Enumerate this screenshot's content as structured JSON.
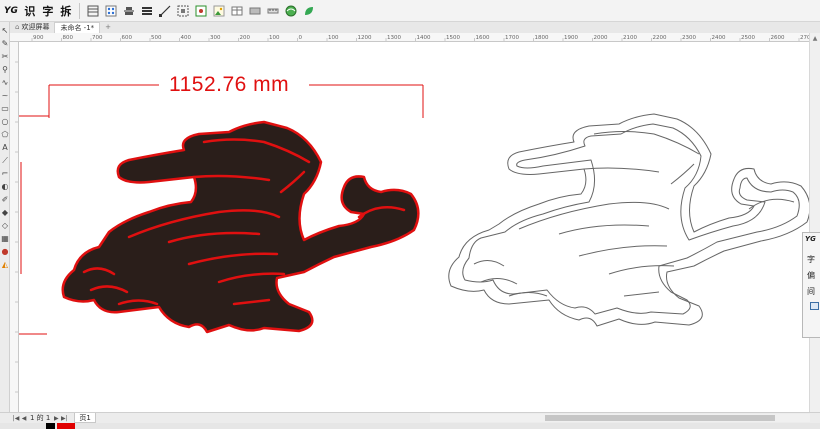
{
  "toolbar": {
    "logo_label": "YG",
    "btn_recognize": "识",
    "btn_text": "字",
    "btn_break": "拆",
    "icons": [
      "grid-icon",
      "dots-icon",
      "align-icon",
      "distribute-icon",
      "line-icon",
      "group-icon",
      "node-icon",
      "image-icon",
      "table-icon",
      "pattern-icon",
      "ruler-icon",
      "globe-icon",
      "leaf-icon"
    ]
  },
  "tabs": [
    {
      "label": "欢迎屏幕",
      "active": false
    },
    {
      "label": "未命名 -1*",
      "active": true
    }
  ],
  "ruler": {
    "h_ticks": [
      "900",
      "800",
      "700",
      "600",
      "500",
      "400",
      "300",
      "200",
      "100",
      "0",
      "100",
      "1200",
      "1300",
      "1400",
      "1500",
      "1600",
      "1700",
      "1800",
      "1900",
      "2000",
      "2100",
      "2200",
      "2300",
      "2400",
      "2500",
      "2600",
      "2700"
    ]
  },
  "canvas": {
    "dimension_label": "1152.76 mm",
    "accent_color": "#e01010",
    "fill_color": "#2a1e1a"
  },
  "panel": {
    "title": "YG",
    "rows": [
      "字",
      "偏",
      "间"
    ]
  },
  "pagebar": {
    "page_of": "1 的 1",
    "page_tab": "页1"
  },
  "colors": {
    "swatch_black": "#000000",
    "swatch_red": "#e00000"
  }
}
